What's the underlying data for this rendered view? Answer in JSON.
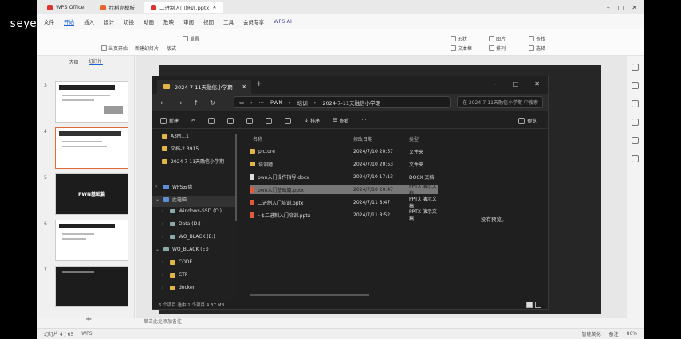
{
  "overlay": {
    "brand": "seye"
  },
  "titlebar": {
    "tabs": [
      {
        "label": "WPS Office",
        "active": false
      },
      {
        "label": "找稻壳模板",
        "active": false
      },
      {
        "label": "二进制入门培训.pptx",
        "active": true
      }
    ]
  },
  "menubar": {
    "items": [
      "文件",
      "开始",
      "插入",
      "设计",
      "切换",
      "动画",
      "放映",
      "审阅",
      "视图",
      "工具",
      "会员专享"
    ],
    "active": "开始",
    "ai_label": "WPS AI"
  },
  "ribbon": {
    "new_slide": "新建幻灯片",
    "layout": "版式",
    "from_start": "当页开始",
    "reset": "重置",
    "shape": "形状",
    "picture": "图片",
    "find": "查找",
    "textbox": "文本框",
    "arrange": "排列",
    "select": "选择"
  },
  "slidepanel": {
    "tabs": [
      "大纲",
      "幻灯片"
    ],
    "thumbs": [
      {
        "num": "3",
        "title": ""
      },
      {
        "num": "4",
        "title": ""
      },
      {
        "num": "5",
        "title": "PWN基础篇"
      },
      {
        "num": "6",
        "title": ""
      },
      {
        "num": "7",
        "title": ""
      }
    ]
  },
  "slide_note": "单击此处添加备注",
  "statusbar": {
    "page": "幻灯片 4 / 65",
    "app": "WPS",
    "beautify": "智能美化",
    "notes": "备注",
    "zoom": "86%"
  },
  "explorer": {
    "tab_title": "2024-7-11天融信小学期",
    "breadcrumb": [
      "PWN",
      "培训",
      "2024-7-11天融信小学期"
    ],
    "search_placeholder": "在 2024-7-11天融信小学期 中搜索",
    "commands": {
      "new": "新建",
      "sort": "排序",
      "view": "查看",
      "more": "···",
      "preview": "预览"
    },
    "sidebar": [
      {
        "label": "A3M…1",
        "kind": "folder",
        "chev": ""
      },
      {
        "label": "文档-2 3915",
        "kind": "folder",
        "chev": ""
      },
      {
        "label": "2024-7-11天融信小学期",
        "kind": "folder",
        "chev": ""
      },
      {
        "label": "WPS云盘",
        "kind": "cloud",
        "chev": "›"
      },
      {
        "label": "此电脑",
        "kind": "drive",
        "chev": "⌄"
      },
      {
        "label": "Windows-SSD (C:)",
        "kind": "drive",
        "chev": "›"
      },
      {
        "label": "Data (D:)",
        "kind": "drive",
        "chev": "›"
      },
      {
        "label": "WO_BLACK (E:)",
        "kind": "drive",
        "chev": "›"
      },
      {
        "label": "WO_BLACK (E:)",
        "kind": "drive",
        "chev": "⌄"
      },
      {
        "label": "CODE",
        "kind": "folder",
        "chev": "›"
      },
      {
        "label": "CTF",
        "kind": "folder",
        "chev": "›"
      },
      {
        "label": "docker",
        "kind": "folder",
        "chev": "›"
      }
    ],
    "columns": {
      "name": "名称",
      "date": "修改日期",
      "type": "类型"
    },
    "files": [
      {
        "name": "picture",
        "date": "2024/7/10 20:57",
        "type": "文件夹",
        "kind": "folder"
      },
      {
        "name": "培训题",
        "date": "2024/7/10 20:53",
        "type": "文件夹",
        "kind": "folder"
      },
      {
        "name": "pwn入门操作指导.docx",
        "date": "2024/7/10 17:13",
        "type": "DOCX 文档",
        "kind": "doc"
      },
      {
        "name": "pwn入门基础篇.pptx",
        "date": "2024/7/10 20:47",
        "type": "PPTX 演示文稿",
        "kind": "ppt"
      },
      {
        "name": "二进制入门培训.pptx",
        "date": "2024/7/11 8:47",
        "type": "PPTX 演示文稿",
        "kind": "ppt"
      },
      {
        "name": "~$二进制入门培训.pptx",
        "date": "2024/7/11 8:52",
        "type": "PPTX 演示文稿",
        "kind": "ppt"
      }
    ],
    "selected_index": 3,
    "no_preview": "没有预览。",
    "status": "6 个项目   选中 1 个项目 4.37 MB"
  }
}
